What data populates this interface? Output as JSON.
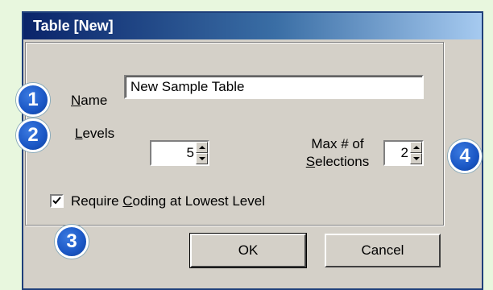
{
  "dialog": {
    "title": "Table [New]"
  },
  "name": {
    "label_u": "N",
    "label_rest": "ame",
    "value": "New Sample Table"
  },
  "levels": {
    "label_u": "L",
    "label_rest": "evels",
    "value": "5"
  },
  "max_selections": {
    "label_line1": "Max # of",
    "label_line2_u": "S",
    "label_line2_rest": "elections",
    "value": "2"
  },
  "require_coding": {
    "label_pre": "Require ",
    "label_u": "C",
    "label_rest": "oding at Lowest Level",
    "checked": true
  },
  "buttons": {
    "ok": "OK",
    "cancel": "Cancel"
  },
  "callouts": [
    "1",
    "2",
    "3",
    "4"
  ],
  "colors": {
    "badge": "#1a56c4",
    "page_bg": "#e8f7de",
    "titlebar": "#0a246a"
  }
}
